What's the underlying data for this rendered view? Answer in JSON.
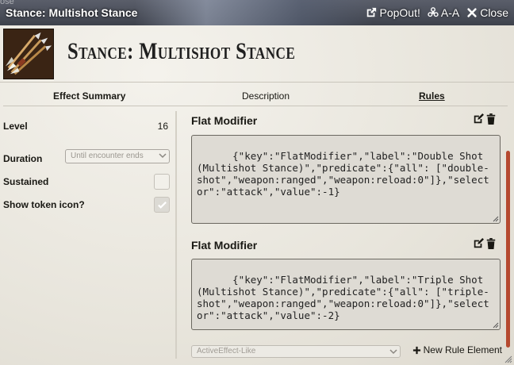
{
  "window": {
    "ghost_text": "ose",
    "title": "Stance: Multishot Stance",
    "controls": {
      "popout_label": "PopOut!",
      "text_size_label": "A-A",
      "close_label": "Close"
    }
  },
  "item": {
    "name": "Stance: Multishot Stance",
    "image_icon": "arrow-bundle-icon"
  },
  "tabs": {
    "summary": "Effect Summary",
    "description": "Description",
    "rules": "Rules",
    "active": "rules"
  },
  "summary": {
    "level_label": "Level",
    "level_value": "16",
    "duration_label": "Duration",
    "duration_value": "Until encounter ends",
    "sustained_label": "Sustained",
    "sustained_checked": false,
    "show_token_label": "Show token icon?",
    "show_token_checked": true
  },
  "rules": {
    "elements": [
      {
        "title": "Flat Modifier",
        "json": "{\"key\":\"FlatModifier\",\"label\":\"Double Shot (Multishot Stance)\",\"predicate\":{\"all\": [\"double-shot\",\"weapon:ranged\",\"weapon:reload:0\"]},\"selector\":\"attack\",\"value\":-1}"
      },
      {
        "title": "Flat Modifier",
        "json": "{\"key\":\"FlatModifier\",\"label\":\"Triple Shot (Multishot Stance)\",\"predicate\":{\"all\": [\"triple-shot\",\"weapon:ranged\",\"weapon:reload:0\"]},\"selector\":\"attack\",\"value\":-2}"
      }
    ],
    "new_element_select": "ActiveEffect-Like",
    "new_element_label": "New Rule Element"
  },
  "colors": {
    "accent": "#b5492f",
    "titlebar": "#4a4e58",
    "panel": "#ece9e1"
  }
}
